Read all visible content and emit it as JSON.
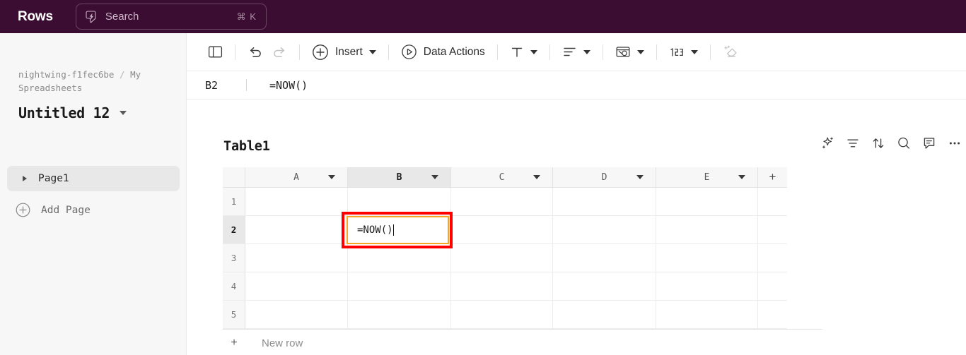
{
  "topbar": {
    "brand": "Rows",
    "search": {
      "icon": "bolt-icon",
      "placeholder": "Search",
      "shortcut": "⌘ K"
    },
    "background_color": "#3c0d33"
  },
  "sidebar": {
    "breadcrumb": {
      "workspace": "nightwing-f1fec6be",
      "separator": "/",
      "folder": "My Spreadsheets"
    },
    "document_title": "Untitled 12",
    "pages": [
      {
        "label": "Page1",
        "selected": true
      }
    ],
    "add_page_label": "Add Page"
  },
  "toolbar": {
    "items": [
      {
        "name": "toggle-sidebar",
        "icon": "panel-icon",
        "label": ""
      },
      {
        "name": "undo",
        "icon": "undo-icon",
        "label": "",
        "disabled": false
      },
      {
        "name": "redo",
        "icon": "redo-icon",
        "label": "",
        "disabled": true
      },
      {
        "name": "insert",
        "icon": "plus-circle-icon",
        "label": "Insert",
        "has_caret": true
      },
      {
        "name": "data-actions",
        "icon": "play-circle-icon",
        "label": "Data Actions"
      },
      {
        "name": "text-format",
        "icon": "text-format-icon",
        "label": "",
        "has_caret": true
      },
      {
        "name": "align",
        "icon": "align-icon",
        "label": "",
        "has_caret": true
      },
      {
        "name": "fill-color",
        "icon": "fill-color-icon",
        "label": "",
        "has_caret": true
      },
      {
        "name": "number-format",
        "icon": "number-format-icon",
        "label": "",
        "has_caret": true
      },
      {
        "name": "clear-format",
        "icon": "eraser-icon",
        "label": "",
        "disabled": true
      }
    ],
    "insert_label": "Insert",
    "data_actions_label": "Data Actions"
  },
  "formula_bar": {
    "cell_reference": "B2",
    "formula": "=NOW()"
  },
  "table": {
    "name": "Table1",
    "actions": [
      {
        "name": "ai-assist-icon"
      },
      {
        "name": "filter-icon"
      },
      {
        "name": "sort-icon"
      },
      {
        "name": "search-icon"
      },
      {
        "name": "comment-icon"
      },
      {
        "name": "more-options-icon"
      }
    ],
    "columns": [
      {
        "label": "A",
        "active": false
      },
      {
        "label": "B",
        "active": true
      },
      {
        "label": "C",
        "active": false
      },
      {
        "label": "D",
        "active": false
      },
      {
        "label": "E",
        "active": false
      }
    ],
    "add_column_label": "+",
    "rows": [
      {
        "number": "1",
        "active": false,
        "cells": [
          "",
          "",
          "",
          "",
          ""
        ]
      },
      {
        "number": "2",
        "active": true,
        "cells": [
          "",
          "=NOW()",
          "",
          "",
          ""
        ]
      },
      {
        "number": "3",
        "active": false,
        "cells": [
          "",
          "",
          "",
          "",
          ""
        ]
      },
      {
        "number": "4",
        "active": false,
        "cells": [
          "",
          "",
          "",
          "",
          ""
        ]
      },
      {
        "number": "5",
        "active": false,
        "cells": [
          "",
          "",
          "",
          "",
          ""
        ]
      }
    ],
    "new_row_label": "New row",
    "new_row_plus": "+"
  },
  "cell_editor": {
    "value": "=NOW()",
    "active_cell": "B2",
    "border_color": "#f5a623",
    "annotation_color": "#ff0000"
  }
}
